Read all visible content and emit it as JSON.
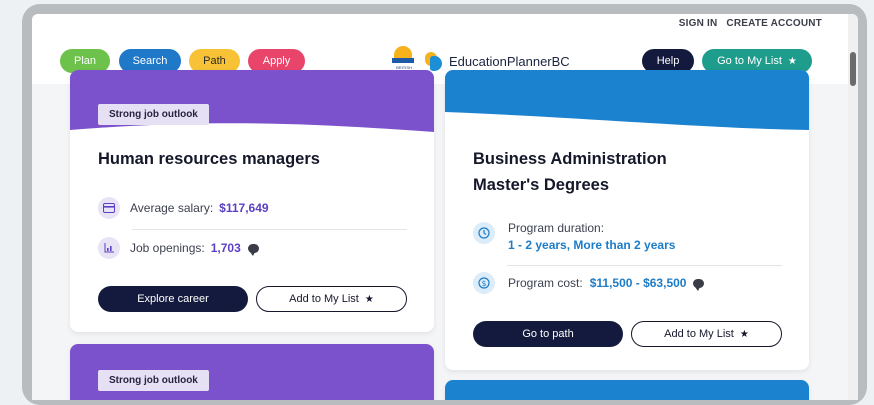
{
  "top_links": {
    "sign_in": "SIGN IN",
    "create_account": "CREATE ACCOUNT"
  },
  "nav": {
    "plan": "Plan",
    "search": "Search",
    "path": "Path",
    "apply": "Apply",
    "help": "Help",
    "go_to_my_list": "Go to My List"
  },
  "logo": {
    "bc_text": "BRITISH COLUMBIA",
    "brand": "EducationPlannerBC"
  },
  "cards": {
    "career": {
      "badge": "Strong job outlook",
      "title": "Human resources managers",
      "salary_label": "Average salary:",
      "salary_value": "$117,649",
      "openings_label": "Job openings:",
      "openings_value": "1,703",
      "explore_button": "Explore career",
      "add_button": "Add to My List"
    },
    "program": {
      "title_line1": "Business Administration",
      "title_line2": "Master's Degrees",
      "duration_label": "Program duration:",
      "duration_value": "1 - 2 years, More than 2 years",
      "cost_label": "Program cost:",
      "cost_value": "$11,500 - $63,500",
      "path_button": "Go to path",
      "add_button": "Add to My List"
    },
    "career2": {
      "badge": "Strong job outlook"
    }
  },
  "colors": {
    "plan": "#6cc24a",
    "search": "#1f78c8",
    "path": "#f7c236",
    "apply": "#e9456a",
    "help": "#131a3d",
    "my_list": "#1e9c8c",
    "career_band": "#7b52cc",
    "program_band": "#1a82cf"
  }
}
